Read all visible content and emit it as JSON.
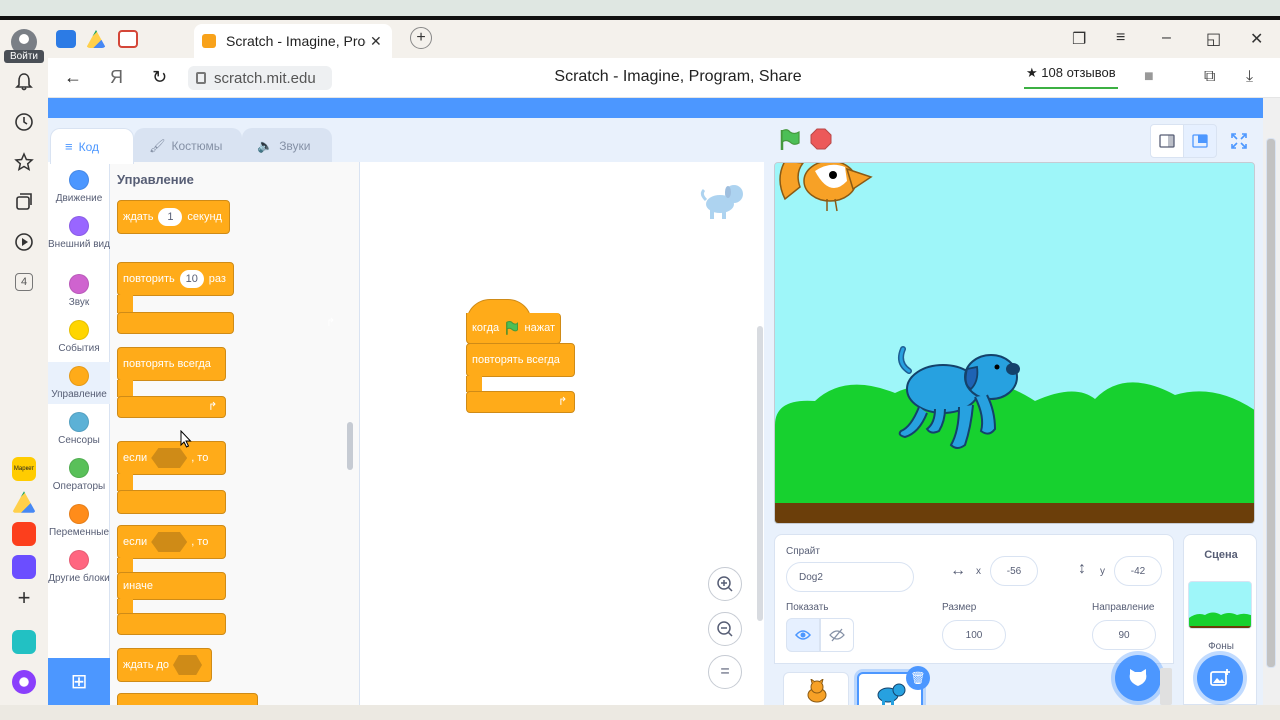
{
  "browser": {
    "login_label": "Войти",
    "sidebar_badge": "4",
    "market_label": "Маркет",
    "tab_title": "Scratch - Imagine, Progr",
    "tab_close": "✕",
    "new_tab": "+",
    "back_glyph": "←",
    "yandex_glyph": "Я",
    "reload_glyph": "↻",
    "url": "scratch.mit.edu",
    "page_title": "Scratch - Imagine, Program, Share",
    "reviews": "★ 108 отзывов"
  },
  "editor": {
    "tabs": [
      {
        "label": "Код"
      },
      {
        "label": "Костюмы"
      },
      {
        "label": "Звуки"
      }
    ],
    "categories": [
      {
        "label": "Движение",
        "color": "#4c97ff"
      },
      {
        "label": "Внешний вид",
        "color": "#9966ff"
      },
      {
        "label": "Звук",
        "color": "#cf63cf"
      },
      {
        "label": "События",
        "color": "#ffd500"
      },
      {
        "label": "Управление",
        "color": "#ffab19"
      },
      {
        "label": "Сенсоры",
        "color": "#5cb1d6"
      },
      {
        "label": "Операторы",
        "color": "#59c059"
      },
      {
        "label": "Переменные",
        "color": "#ff8c1a"
      },
      {
        "label": "Другие блоки",
        "color": "#ff6680"
      }
    ],
    "palette": {
      "heading": "Управление",
      "wait_label": "ждать",
      "wait_value": "1",
      "wait_unit": "секунд",
      "repeat_label": "повторить",
      "repeat_value": "10",
      "repeat_unit": "раз",
      "forever_label": "повторять всегда",
      "if_label": "если",
      "then_label": ", то",
      "if2_label": "если",
      "then2_label": ", то",
      "else_label": "иначе",
      "wait_until_label": "ждать до"
    },
    "script": {
      "when_label": "когда",
      "clicked_label": "нажат",
      "forever_label": "повторять всегда"
    }
  },
  "sprite_info": {
    "sprite_label": "Спрайт",
    "sprite_name": "Dog2",
    "x_label": "x",
    "x_value": "-56",
    "y_label": "y",
    "y_value": "-42",
    "show_label": "Показать",
    "size_label": "Размер",
    "size_value": "100",
    "direction_label": "Направление",
    "direction_value": "90"
  },
  "stage_panel": {
    "title": "Сцена",
    "backdrops_label": "Фоны"
  },
  "colors": {
    "scratch_blue": "#4c97ff",
    "control_orange": "#ffab19",
    "stage_sky": "#9ef6f9",
    "stage_grass": "#17d12f",
    "stage_ground": "#6b3e0a"
  }
}
